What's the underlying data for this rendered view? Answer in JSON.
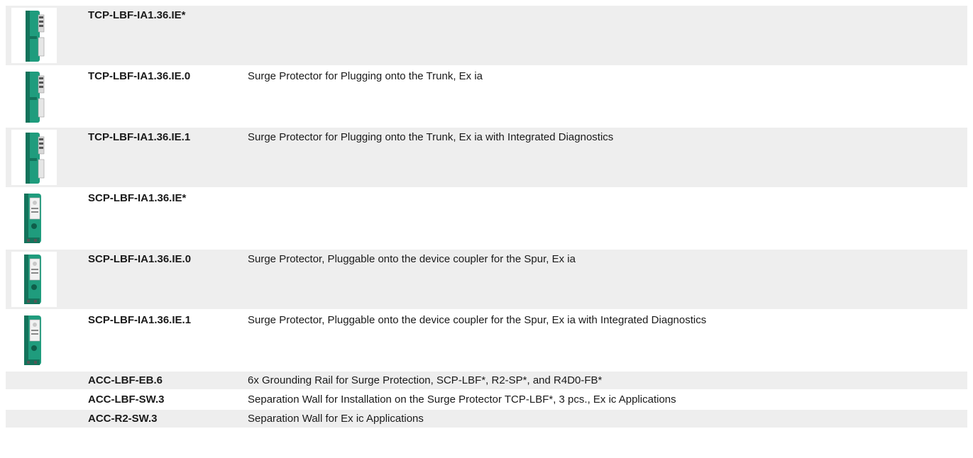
{
  "rows": [
    {
      "code": "TCP-LBF-IA1.36.IE*",
      "description": "",
      "image": "tcp-surge-protector",
      "tall": true
    },
    {
      "code": "TCP-LBF-IA1.36.IE.0",
      "description": "Surge Protector for Plugging onto the Trunk, Ex ia",
      "image": "tcp-surge-protector",
      "tall": true
    },
    {
      "code": "TCP-LBF-IA1.36.IE.1",
      "description": "Surge Protector for Plugging onto the Trunk, Ex ia with Integrated Diagnostics",
      "image": "tcp-surge-protector",
      "tall": true
    },
    {
      "code": "SCP-LBF-IA1.36.IE*",
      "description": "",
      "image": "scp-surge-protector",
      "tall": true
    },
    {
      "code": "SCP-LBF-IA1.36.IE.0",
      "description": "Surge Protector, Pluggable onto the device coupler for the Spur, Ex ia",
      "image": "scp-surge-protector",
      "tall": true
    },
    {
      "code": "SCP-LBF-IA1.36.IE.1",
      "description": "Surge Protector, Pluggable onto the device coupler for the Spur, Ex ia with Integrated Diagnostics",
      "image": "scp-surge-protector",
      "tall": true
    },
    {
      "code": "ACC-LBF-EB.6",
      "description": "6x Grounding Rail for Surge Protection, SCP-LBF*, R2-SP*, and R4D0-FB*",
      "image": "",
      "tall": false
    },
    {
      "code": "ACC-LBF-SW.3",
      "description": "Separation Wall for Installation on the Surge Protector TCP-LBF*, 3 pcs., Ex ic Applications",
      "image": "",
      "tall": false
    },
    {
      "code": "ACC-R2-SW.3",
      "description": "Separation Wall for Ex ic Applications",
      "image": "",
      "tall": false
    }
  ],
  "colors": {
    "row_shade": "#eeeeee",
    "product_green": "#1f9c7d",
    "product_green_dark": "#13735b"
  }
}
